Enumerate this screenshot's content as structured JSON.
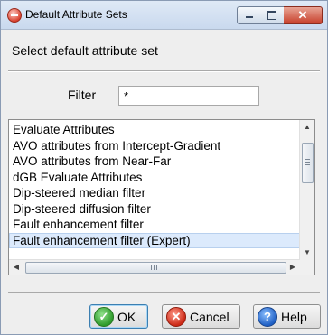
{
  "window": {
    "title": "Default Attribute Sets",
    "close_glyph": "✕"
  },
  "dialog": {
    "instruction": "Select default attribute set"
  },
  "filter": {
    "label": "Filter",
    "value": "*"
  },
  "attribute_sets": {
    "items": [
      "Evaluate Attributes",
      "AVO attributes from Intercept-Gradient",
      "AVO attributes from Near-Far",
      "dGB Evaluate Attributes",
      "Dip-steered median filter",
      "Dip-steered diffusion filter",
      "Fault enhancement filter",
      "Fault enhancement filter (Expert)"
    ],
    "selected": "Fault enhancement filter (Expert)"
  },
  "buttons": {
    "ok_label": "OK",
    "cancel_label": "Cancel",
    "help_label": "Help"
  },
  "icons": {
    "app": "app-icon",
    "ok": "check-icon",
    "cancel": "x-icon",
    "help": "question-icon"
  },
  "colors": {
    "selection_bg": "#dceafc",
    "ok_icon": "#2e9b2b",
    "cancel_icon": "#cc2a17",
    "help_icon": "#1f5fc4"
  }
}
